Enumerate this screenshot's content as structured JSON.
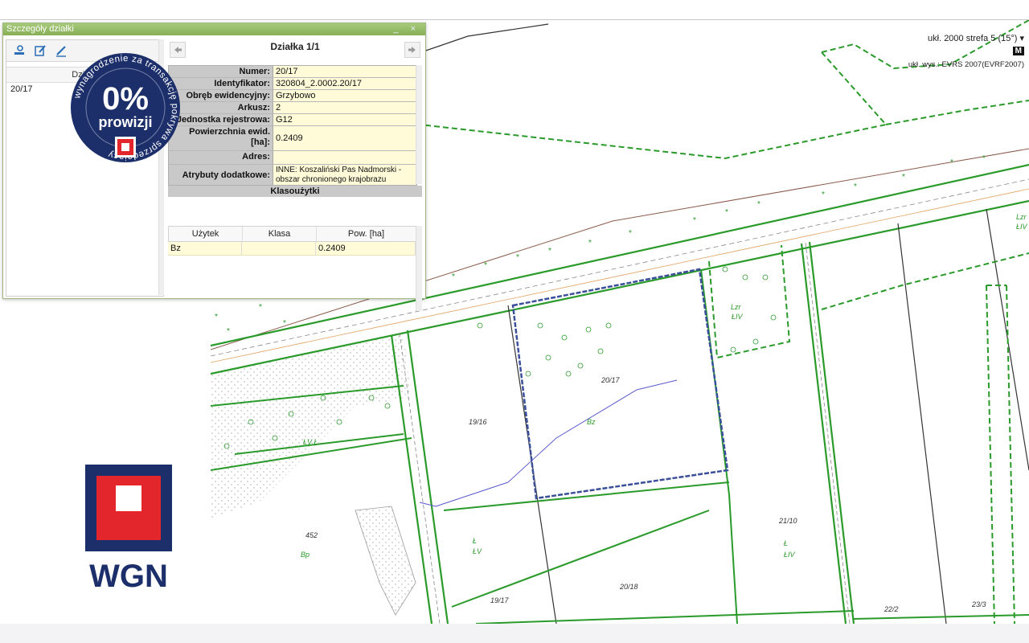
{
  "panel": {
    "title": "Szczegóły działki",
    "controls": "_ ×",
    "list_header": "Działki",
    "list_items": [
      "20/17"
    ],
    "nav_title": "Działka 1/1",
    "attributes": [
      {
        "key": "Numer:",
        "value": "20/17"
      },
      {
        "key": "Identyfikator:",
        "value": "320804_2.0002.20/17"
      },
      {
        "key": "Obręb ewidencyjny:",
        "value": "Grzybowo"
      },
      {
        "key": "Arkusz:",
        "value": "2"
      },
      {
        "key": "Jednostka rejestrowa:",
        "value": "G12"
      },
      {
        "key": "Powierzchnia ewid. [ha]:",
        "value": "0.2409"
      },
      {
        "key": "Adres:",
        "value": ""
      },
      {
        "key": "Atrybuty dodatkowe:",
        "value": "INNE: Koszaliński Pas Nadmorski - obszar chronionego krajobrazu"
      }
    ],
    "klasouzytki_title": "Klasoużytki",
    "klas_headers": [
      "Użytek",
      "Klasa",
      "Pow. [ha]"
    ],
    "klas_rows": [
      [
        "Bz",
        "",
        "0.2409"
      ]
    ]
  },
  "map": {
    "coord_system": "ukł. 2000 strefa 5 (15°) ▾",
    "m_button": "M",
    "height_system": "ukł. wys.: EVRS 2007(EVRF2007)",
    "labels": [
      {
        "t": "20/17"
      },
      {
        "t": "Bz"
      },
      {
        "t": "19/16"
      },
      {
        "t": "ŁV  Ł"
      },
      {
        "t": "452"
      },
      {
        "t": "Bp"
      },
      {
        "t": "Ł"
      },
      {
        "t": "ŁV"
      },
      {
        "t": "20/18"
      },
      {
        "t": "19/17"
      },
      {
        "t": "21/10"
      },
      {
        "t": "Ł"
      },
      {
        "t": "ŁIV"
      },
      {
        "t": "22/2"
      },
      {
        "t": "23/3"
      },
      {
        "t": "Lzr"
      },
      {
        "t": "ŁIV"
      },
      {
        "t": "Lzr"
      },
      {
        "t": "ŁIV"
      }
    ]
  },
  "badge": {
    "percent": "0%",
    "word": "prowizji",
    "ring_text": "wynagrodzenie za transakcję pokrywa sprzedający"
  },
  "logo": {
    "text": "WGN"
  },
  "colors": {
    "parcel_green": "#2a9a2a",
    "selected_blue": "#3a4f9a",
    "badge_navy": "#1c2f6b",
    "logo_red": "#e2262c",
    "panel_header": "#93b865",
    "value_bg": "#fffbd8"
  }
}
